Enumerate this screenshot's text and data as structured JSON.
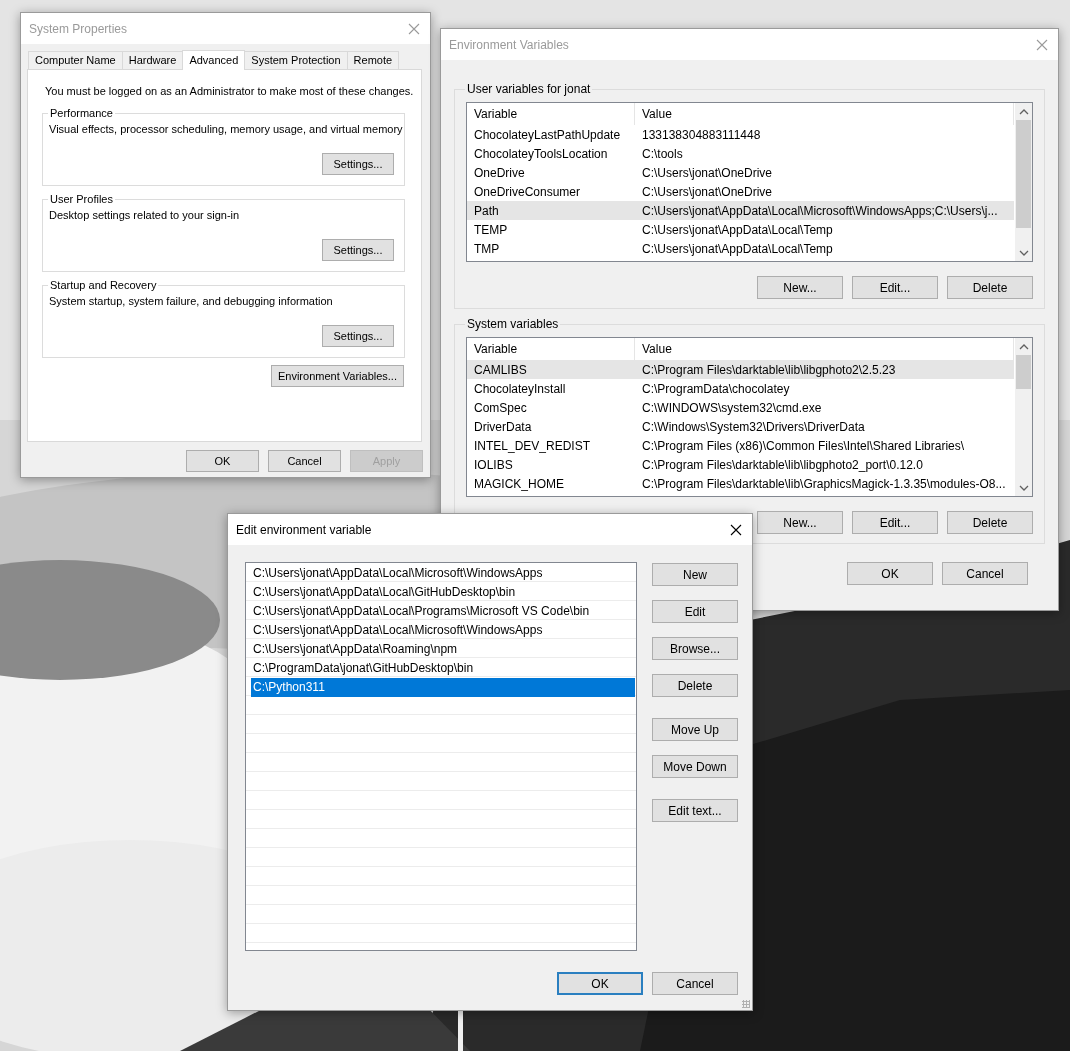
{
  "system_properties": {
    "title": "System Properties",
    "active": false,
    "tabs": [
      {
        "label": "Computer Name",
        "selected": false
      },
      {
        "label": "Hardware",
        "selected": false
      },
      {
        "label": "Advanced",
        "selected": true
      },
      {
        "label": "System Protection",
        "selected": false
      },
      {
        "label": "Remote",
        "selected": false
      }
    ],
    "notice": "You must be logged on as an Administrator to make most of these changes.",
    "groups": [
      {
        "title": "Performance",
        "description": "Visual effects, processor scheduling, memory usage, and virtual memory",
        "button": "Settings..."
      },
      {
        "title": "User Profiles",
        "description": "Desktop settings related to your sign-in",
        "button": "Settings..."
      },
      {
        "title": "Startup and Recovery",
        "description": "System startup, system failure, and debugging information",
        "button": "Settings..."
      }
    ],
    "env_button": "Environment Variables...",
    "buttons": [
      {
        "label": "OK",
        "disabled": false
      },
      {
        "label": "Cancel",
        "disabled": false
      },
      {
        "label": "Apply",
        "disabled": true
      }
    ]
  },
  "environment_variables": {
    "title": "Environment Variables",
    "active": false,
    "sections": [
      {
        "title": "User variables for jonat",
        "columns": [
          "Variable",
          "Value"
        ],
        "rows": [
          {
            "variable": "ChocolateyLastPathUpdate",
            "value": "133138304883111448",
            "selected": false
          },
          {
            "variable": "ChocolateyToolsLocation",
            "value": "C:\\tools",
            "selected": false
          },
          {
            "variable": "OneDrive",
            "value": "C:\\Users\\jonat\\OneDrive",
            "selected": false
          },
          {
            "variable": "OneDriveConsumer",
            "value": "C:\\Users\\jonat\\OneDrive",
            "selected": false
          },
          {
            "variable": "Path",
            "value": "C:\\Users\\jonat\\AppData\\Local\\Microsoft\\WindowsApps;C:\\Users\\j...",
            "selected": true
          },
          {
            "variable": "TEMP",
            "value": "C:\\Users\\jonat\\AppData\\Local\\Temp",
            "selected": false
          },
          {
            "variable": "TMP",
            "value": "C:\\Users\\jonat\\AppData\\Local\\Temp",
            "selected": false
          }
        ],
        "buttons": [
          "New...",
          "Edit...",
          "Delete"
        ]
      },
      {
        "title": "System variables",
        "columns": [
          "Variable",
          "Value"
        ],
        "rows": [
          {
            "variable": "CAMLIBS",
            "value": "C:\\Program Files\\darktable\\lib\\libgphoto2\\2.5.23",
            "selected": true
          },
          {
            "variable": "ChocolateyInstall",
            "value": "C:\\ProgramData\\chocolatey",
            "selected": false
          },
          {
            "variable": "ComSpec",
            "value": "C:\\WINDOWS\\system32\\cmd.exe",
            "selected": false
          },
          {
            "variable": "DriverData",
            "value": "C:\\Windows\\System32\\Drivers\\DriverData",
            "selected": false
          },
          {
            "variable": "INTEL_DEV_REDIST",
            "value": "C:\\Program Files (x86)\\Common Files\\Intel\\Shared Libraries\\",
            "selected": false
          },
          {
            "variable": "IOLIBS",
            "value": "C:\\Program Files\\darktable\\lib\\libgphoto2_port\\0.12.0",
            "selected": false
          },
          {
            "variable": "MAGICK_HOME",
            "value": "C:\\Program Files\\darktable\\lib\\GraphicsMagick-1.3.35\\modules-O8...",
            "selected": false
          }
        ],
        "buttons": [
          "New...",
          "Edit...",
          "Delete"
        ]
      }
    ],
    "buttons": [
      "OK",
      "Cancel"
    ]
  },
  "edit_dialog": {
    "title": "Edit environment variable",
    "active": true,
    "entries": [
      {
        "text": "C:\\Users\\jonat\\AppData\\Local\\Microsoft\\WindowsApps",
        "selected": false
      },
      {
        "text": "C:\\Users\\jonat\\AppData\\Local\\GitHubDesktop\\bin",
        "selected": false
      },
      {
        "text": "C:\\Users\\jonat\\AppData\\Local\\Programs\\Microsoft VS Code\\bin",
        "selected": false
      },
      {
        "text": "C:\\Users\\jonat\\AppData\\Local\\Microsoft\\WindowsApps",
        "selected": false
      },
      {
        "text": "C:\\Users\\jonat\\AppData\\Roaming\\npm",
        "selected": false
      },
      {
        "text": "C:\\ProgramData\\jonat\\GitHubDesktop\\bin",
        "selected": false
      },
      {
        "text": "C:\\Python311",
        "selected": true
      }
    ],
    "button_groups": [
      [
        "New",
        "Edit",
        "Browse...",
        "Delete"
      ],
      [
        "Move Up",
        "Move Down"
      ],
      [
        "Edit text..."
      ]
    ],
    "buttons": [
      {
        "label": "OK",
        "default": true
      },
      {
        "label": "Cancel",
        "default": false
      }
    ]
  }
}
